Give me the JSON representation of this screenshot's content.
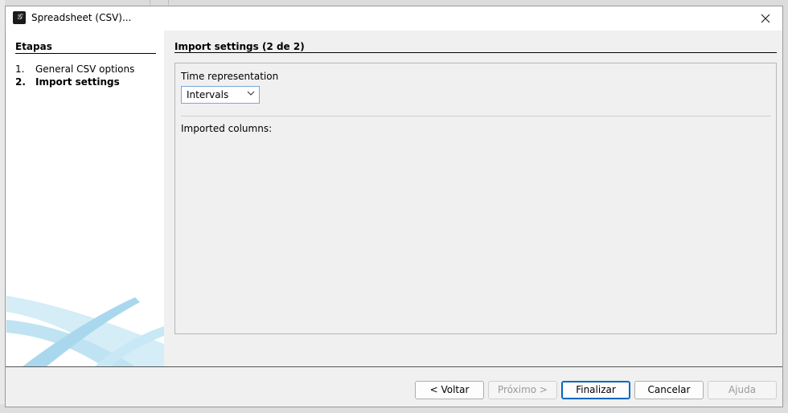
{
  "dialog": {
    "title": "Spreadsheet (CSV)...",
    "icon": "app-logo-icon"
  },
  "sidebar": {
    "title": "Etapas",
    "steps": [
      {
        "num": "1.",
        "label": "General CSV options",
        "active": false
      },
      {
        "num": "2.",
        "label": "Import settings",
        "active": true
      }
    ]
  },
  "main": {
    "title": "Import settings (2 de 2)",
    "time_representation_label": "Time representation",
    "time_representation_value": "Intervals",
    "imported_columns_label": "Imported columns:"
  },
  "buttons": {
    "back": "< Voltar",
    "next": "Próximo >",
    "finish": "Finalizar",
    "cancel": "Cancelar",
    "help": "Ajuda"
  },
  "colors": {
    "accent": "#0067c0",
    "swoosh": "#bfe3f2"
  }
}
